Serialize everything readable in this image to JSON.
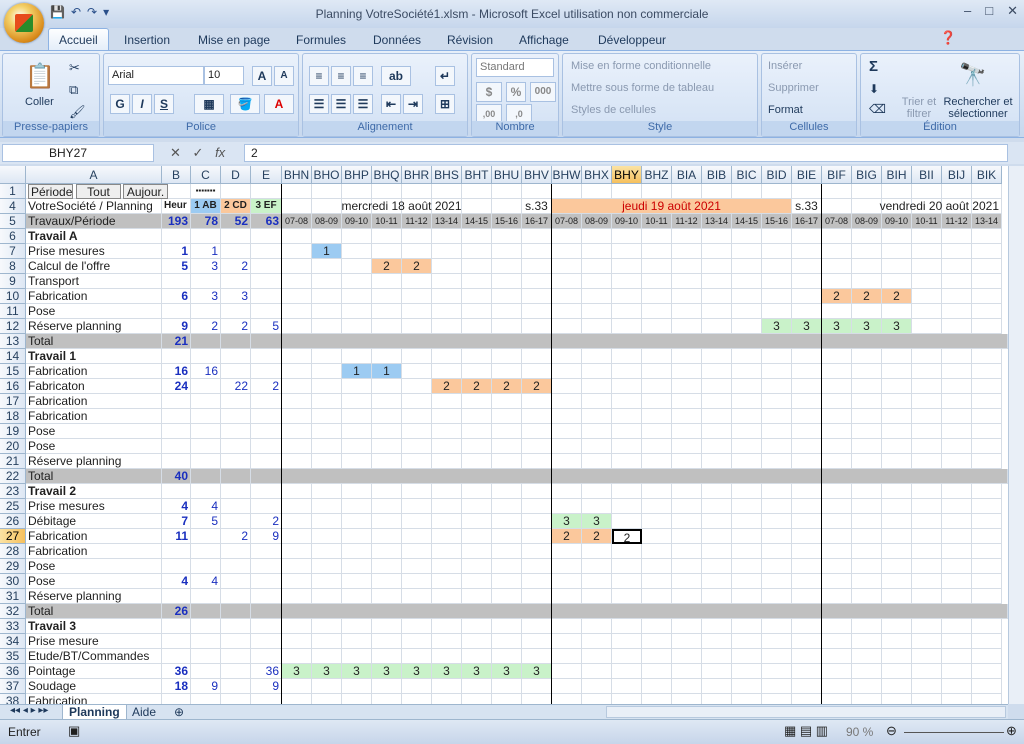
{
  "window": {
    "title": "Planning VotreSociété1.xlsm - Microsoft Excel utilisation non commerciale",
    "min": "–",
    "max": "□",
    "close": "✕"
  },
  "qat": {
    "save": "💾",
    "undo": "↶",
    "redo": "↷",
    "more": "▾"
  },
  "tabs": [
    "Accueil",
    "Insertion",
    "Mise en page",
    "Formules",
    "Données",
    "Révision",
    "Affichage",
    "Développeur"
  ],
  "ribbon": {
    "clipboard": {
      "label": "Presse-papiers",
      "paste": "Coller"
    },
    "font": {
      "label": "Police",
      "name": "Arial",
      "size": "10",
      "bold": "G",
      "italic": "I",
      "underline": "S"
    },
    "align": {
      "label": "Alignement"
    },
    "number": {
      "label": "Nombre",
      "format": "Standard",
      "percent": "%",
      "thousands": "000"
    },
    "style": {
      "label": "Style",
      "cond": "Mise en forme conditionnelle",
      "table": "Mettre sous forme de tableau",
      "cells": "Styles de cellules"
    },
    "cellsgrp": {
      "label": "Cellules",
      "insert": "Insérer",
      "delete": "Supprimer",
      "format": "Format"
    },
    "edit": {
      "label": "Édition",
      "sigma": "Σ",
      "sort": "Trier et filtrer",
      "find": "Rechercher et sélectionner"
    }
  },
  "formula": {
    "namebox": "BHY27",
    "fx": "fx",
    "value": "2"
  },
  "columns": [
    "A",
    "B",
    "C",
    "D",
    "E",
    "BHN",
    "BHO",
    "BHP",
    "BHQ",
    "BHR",
    "BHS",
    "BHT",
    "BHU",
    "BHV",
    "BHW",
    "BHX",
    "BHY",
    "BHZ",
    "BIA",
    "BIB",
    "BIC",
    "BID",
    "BIE",
    "BIF",
    "BIG",
    "BIH",
    "BII",
    "BIJ",
    "BIK"
  ],
  "rownums": [
    "1",
    "4",
    "5",
    "6",
    "7",
    "8",
    "9",
    "10",
    "11",
    "12",
    "13",
    "14",
    "15",
    "16",
    "17",
    "18",
    "19",
    "20",
    "21",
    "22",
    "23",
    "25",
    "26",
    "27",
    "28",
    "29",
    "30",
    "31",
    "32",
    "33",
    "34",
    "35",
    "36",
    "37",
    "38"
  ],
  "row1": {
    "a1": "Période",
    "a2": "Tout",
    "a3": "Aujour.",
    "c": "▪▪▪▪▪▪▪"
  },
  "row4": {
    "a": "VotreSociété / Planning",
    "b": "Heur",
    "c": "1 AB",
    "d": "2 CD",
    "e": "3 EF",
    "day1": "mercredi 18 août 2021",
    "wk1": "s.33",
    "day2": "jeudi 19 août 2021",
    "wk2": "s.33",
    "day3": "vendredi 20 août 2021"
  },
  "row5": {
    "a": "Travaux/Période",
    "b": "193",
    "c": "78",
    "d": "52",
    "e": "63",
    "slots": [
      "07-08",
      "08-09",
      "09-10",
      "10-11",
      "11-12",
      "13-14",
      "14-15",
      "15-16",
      "16-17",
      "07-08",
      "08-09",
      "09-10",
      "10-11",
      "11-12",
      "13-14",
      "14-15",
      "15-16",
      "16-17",
      "07-08",
      "08-09",
      "09-10",
      "10-11",
      "11-12",
      "13-14"
    ]
  },
  "rows": [
    {
      "a": "Travail A",
      "b": "",
      "c": "",
      "d": "",
      "e": "",
      "bold": true
    },
    {
      "a": "Prise mesures",
      "b": "1",
      "c": "1",
      "d": "",
      "e": ""
    },
    {
      "a": "Calcul de l'offre",
      "b": "5",
      "c": "3",
      "d": "2",
      "e": ""
    },
    {
      "a": "Transport",
      "b": "",
      "c": "",
      "d": "",
      "e": ""
    },
    {
      "a": "Fabrication",
      "b": "6",
      "c": "3",
      "d": "3",
      "e": ""
    },
    {
      "a": "Pose",
      "b": "",
      "c": "",
      "d": "",
      "e": ""
    },
    {
      "a": "Réserve planning",
      "b": "9",
      "c": "2",
      "d": "2",
      "e": "5"
    },
    {
      "a": "Total",
      "b": "21",
      "c": "",
      "d": "",
      "e": "",
      "total": true
    },
    {
      "a": "Travail 1",
      "b": "",
      "c": "",
      "d": "",
      "e": "",
      "bold": true
    },
    {
      "a": "Fabrication",
      "b": "16",
      "c": "16",
      "d": "",
      "e": ""
    },
    {
      "a": "Fabricaton",
      "b": "24",
      "c": "",
      "d": "22",
      "e": "2"
    },
    {
      "a": "Fabrication",
      "b": "",
      "c": "",
      "d": "",
      "e": ""
    },
    {
      "a": "Fabrication",
      "b": "",
      "c": "",
      "d": "",
      "e": ""
    },
    {
      "a": "Pose",
      "b": "",
      "c": "",
      "d": "",
      "e": ""
    },
    {
      "a": "Pose",
      "b": "",
      "c": "",
      "d": "",
      "e": ""
    },
    {
      "a": "Réserve planning",
      "b": "",
      "c": "",
      "d": "",
      "e": ""
    },
    {
      "a": "Total",
      "b": "40",
      "c": "",
      "d": "",
      "e": "",
      "total": true
    },
    {
      "a": "Travail 2",
      "b": "",
      "c": "",
      "d": "",
      "e": "",
      "bold": true
    },
    {
      "a": "Prise mesures",
      "b": "4",
      "c": "4",
      "d": "",
      "e": ""
    },
    {
      "a": "Débitage",
      "b": "7",
      "c": "5",
      "d": "",
      "e": "2"
    },
    {
      "a": "Fabrication",
      "b": "11",
      "c": "",
      "d": "2",
      "e": "9"
    },
    {
      "a": "Fabrication",
      "b": "",
      "c": "",
      "d": "",
      "e": ""
    },
    {
      "a": "Pose",
      "b": "",
      "c": "",
      "d": "",
      "e": ""
    },
    {
      "a": "Pose",
      "b": "4",
      "c": "4",
      "d": "",
      "e": ""
    },
    {
      "a": "Réserve planning",
      "b": "",
      "c": "",
      "d": "",
      "e": ""
    },
    {
      "a": "Total",
      "b": "26",
      "c": "",
      "d": "",
      "e": "",
      "total": true
    },
    {
      "a": "Travail 3",
      "b": "",
      "c": "",
      "d": "",
      "e": "",
      "bold": true
    },
    {
      "a": "Prise mesure",
      "b": "",
      "c": "",
      "d": "",
      "e": ""
    },
    {
      "a": "Etude/BT/Commandes",
      "b": "",
      "c": "",
      "d": "",
      "e": ""
    },
    {
      "a": "Pointage",
      "b": "36",
      "c": "",
      "d": "",
      "e": "36"
    },
    {
      "a": "Soudage",
      "b": "18",
      "c": "9",
      "d": "",
      "e": "9"
    },
    {
      "a": "Fabrication",
      "b": "",
      "c": "",
      "d": "",
      "e": ""
    }
  ],
  "marks": [
    {
      "row": 1,
      "col": 1,
      "v": "1",
      "color": "#9ccbf2"
    },
    {
      "row": 2,
      "col": 3,
      "v": "2",
      "color": "#fbc89c"
    },
    {
      "row": 2,
      "col": 4,
      "v": "2",
      "color": "#fbc89c"
    },
    {
      "row": 4,
      "col": 18,
      "v": "2",
      "color": "#fbc89c"
    },
    {
      "row": 4,
      "col": 19,
      "v": "2",
      "color": "#fbc89c"
    },
    {
      "row": 4,
      "col": 20,
      "v": "2",
      "color": "#fbc89c"
    },
    {
      "row": 6,
      "col": 16,
      "v": "3",
      "color": "#c9f2c9"
    },
    {
      "row": 6,
      "col": 17,
      "v": "3",
      "color": "#c9f2c9"
    },
    {
      "row": 6,
      "col": 18,
      "v": "3",
      "color": "#c9f2c9"
    },
    {
      "row": 6,
      "col": 19,
      "v": "3",
      "color": "#c9f2c9"
    },
    {
      "row": 6,
      "col": 20,
      "v": "3",
      "color": "#c9f2c9"
    },
    {
      "row": 9,
      "col": 2,
      "v": "1",
      "color": "#9ccbf2"
    },
    {
      "row": 9,
      "col": 3,
      "v": "1",
      "color": "#9ccbf2"
    },
    {
      "row": 10,
      "col": 5,
      "v": "2",
      "color": "#fbc89c"
    },
    {
      "row": 10,
      "col": 6,
      "v": "2",
      "color": "#fbc89c"
    },
    {
      "row": 10,
      "col": 7,
      "v": "2",
      "color": "#fbc89c"
    },
    {
      "row": 10,
      "col": 8,
      "v": "2",
      "color": "#fbc89c"
    },
    {
      "row": 19,
      "col": 9,
      "v": "3",
      "color": "#c9f2c9"
    },
    {
      "row": 19,
      "col": 10,
      "v": "3",
      "color": "#c9f2c9"
    },
    {
      "row": 20,
      "col": 9,
      "v": "2",
      "color": "#fbc89c"
    },
    {
      "row": 20,
      "col": 10,
      "v": "2",
      "color": "#fbc89c"
    },
    {
      "row": 20,
      "col": 11,
      "v": "2",
      "color": "#ffffff",
      "active": true
    },
    {
      "row": 29,
      "col": 0,
      "v": "3",
      "color": "#c9f2c9"
    },
    {
      "row": 29,
      "col": 1,
      "v": "3",
      "color": "#c9f2c9"
    },
    {
      "row": 29,
      "col": 2,
      "v": "3",
      "color": "#c9f2c9"
    },
    {
      "row": 29,
      "col": 3,
      "v": "3",
      "color": "#c9f2c9"
    },
    {
      "row": 29,
      "col": 4,
      "v": "3",
      "color": "#c9f2c9"
    },
    {
      "row": 29,
      "col": 5,
      "v": "3",
      "color": "#c9f2c9"
    },
    {
      "row": 29,
      "col": 6,
      "v": "3",
      "color": "#c9f2c9"
    },
    {
      "row": 29,
      "col": 7,
      "v": "3",
      "color": "#c9f2c9"
    },
    {
      "row": 29,
      "col": 8,
      "v": "3",
      "color": "#c9f2c9"
    }
  ],
  "sheets": [
    "Planning",
    "Aide"
  ],
  "status": {
    "mode": "Entrer",
    "zoom": "90 %"
  }
}
